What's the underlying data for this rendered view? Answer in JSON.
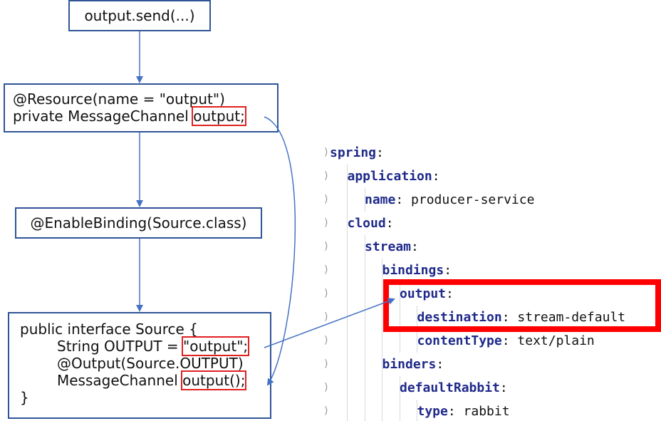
{
  "flow": {
    "box1": {
      "text": "output.send(...)"
    },
    "box2": {
      "line1": "@Resource(name = \"output\")",
      "line2_prefix": "private MessageChannel ",
      "line2_highlight": "output;"
    },
    "box3": {
      "text": "@EnableBinding(Source.class)"
    },
    "box4": {
      "line1": "public interface Source {",
      "line2_prefix": "String OUTPUT = ",
      "line2_highlight": "\"output\";",
      "line3": "@Output(Source.OUTPUT)",
      "line4_prefix": "MessageChannel ",
      "line4_highlight": "output();",
      "line5": "}"
    }
  },
  "yaml": [
    {
      "key": "spring",
      "sep": ":",
      "value": ""
    },
    {
      "key": "application",
      "sep": ":",
      "value": ""
    },
    {
      "key": "name",
      "sep": ":",
      "value": " producer-service"
    },
    {
      "key": "cloud",
      "sep": ":",
      "value": ""
    },
    {
      "key": "stream",
      "sep": ":",
      "value": ""
    },
    {
      "key": "bindings",
      "sep": ":",
      "value": ""
    },
    {
      "key": "output",
      "sep": ":",
      "value": ""
    },
    {
      "key": "destination",
      "sep": ":",
      "value": " stream-default"
    },
    {
      "key": "contentType",
      "sep": ":",
      "value": " text/plain"
    },
    {
      "key": "binders",
      "sep": ":",
      "value": ""
    },
    {
      "key": "defaultRabbit",
      "sep": ":",
      "value": ""
    },
    {
      "key": "type",
      "sep": ":",
      "value": " rabbit"
    }
  ],
  "colors": {
    "box_border": "#2f5597",
    "arrow": "#4472c4",
    "highlight": "#e02020",
    "yaml_highlight": "#ff0000",
    "yaml_key": "#1f2a8a"
  }
}
